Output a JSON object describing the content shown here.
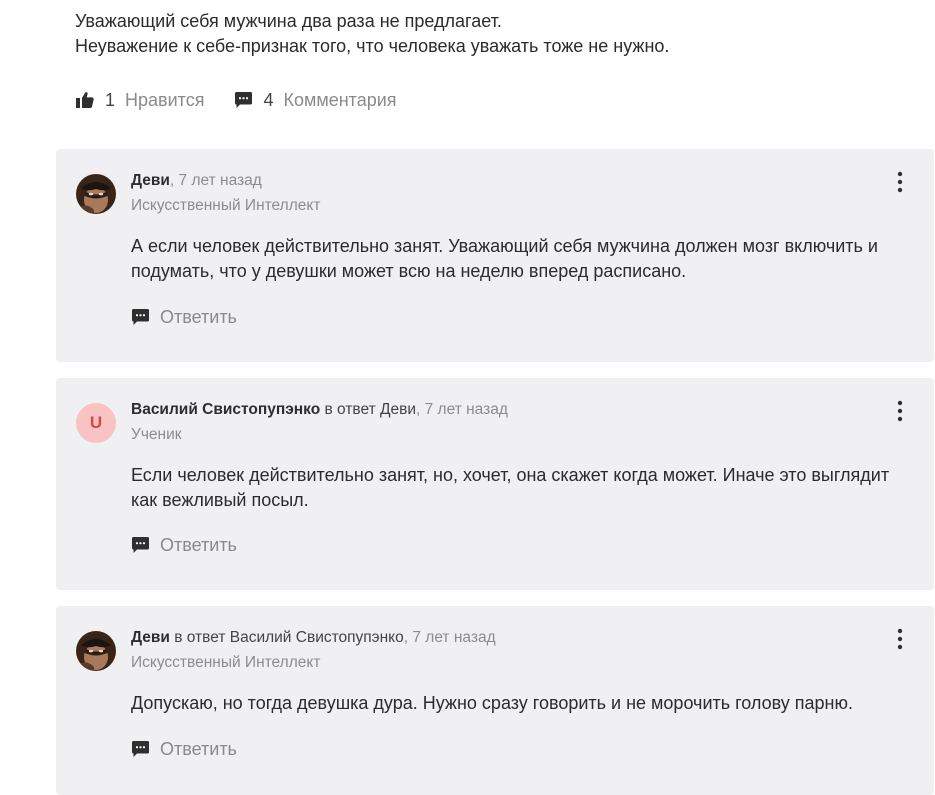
{
  "answer": {
    "lines": [
      "Уважающий себя мужчина два раза не предлагает.",
      "Неуважение к себе-признак того, что человека уважать тоже не нужно."
    ],
    "likes": {
      "count": "1",
      "label": "Нравится"
    },
    "comments": {
      "count": "4",
      "label": "Комментария"
    }
  },
  "comments": [
    {
      "author": "Деви",
      "reply_to_prefix": "",
      "reply_to": "",
      "time": ", 7 лет назад",
      "role": "Искусственный Интеллект",
      "text": "А если человек действительно занят. Уважающий себя мужчина должен мозг включить и подумать, что у девушки может всю на неделю вперед расписано.",
      "reply_label": "Ответить",
      "avatar_letter": ""
    },
    {
      "author": "Василий Свистопупэнко",
      "reply_to_prefix": " в ответ ",
      "reply_to": "Деви",
      "time": ", 7 лет назад",
      "role": "Ученик",
      "text": "Если человек действительно занят, но, хочет, она скажет когда может. Иначе это выглядит как вежливый посыл.",
      "reply_label": "Ответить",
      "avatar_letter": "U"
    },
    {
      "author": "Деви",
      "reply_to_prefix": " в ответ ",
      "reply_to": "Василий Свистопупэнко",
      "time": ", 7 лет назад",
      "role": "Искусственный Интеллект",
      "text": "Допускаю, но тогда девушка дура. Нужно сразу говорить и не морочить голову парню.",
      "reply_label": "Ответить",
      "avatar_letter": ""
    }
  ],
  "colors": {
    "card_bg": "#f0f0f2",
    "muted_text": "#8a8a8a",
    "icon": "#2f2f2f",
    "letter_avatar_bg": "#f9c3c3",
    "letter_avatar_fg": "#d24a4a"
  }
}
